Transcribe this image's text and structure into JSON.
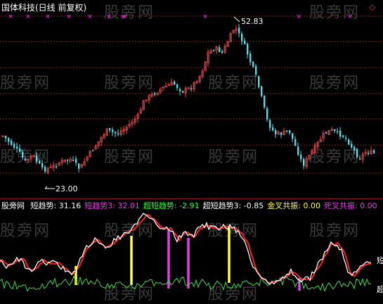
{
  "header": {
    "title": "国体科技(日线 前复权)",
    "diamond_icon": "diamond-icon"
  },
  "watermark": "股旁网",
  "price_chart": {
    "high_label": "52.83",
    "low_label": "23.00",
    "colors": {
      "up": "#ff3b3b",
      "down": "#4fe0ee",
      "grid": "#8b1a1a",
      "marker": "#ff33ff"
    }
  },
  "indicator_bar": {
    "panel_name": "股旁网",
    "items": [
      {
        "label": "短趋势: 31.16",
        "color": "#ffffff"
      },
      {
        "label": "短趋势3: 32.01",
        "color": "#e040e0"
      },
      {
        "label": "超短趋势: -2.91",
        "color": "#33ff33"
      },
      {
        "label": "超短趋势3: -0.85",
        "color": "#ffffff"
      },
      {
        "label": "金叉共振: 0.00",
        "color": "#ffff33"
      },
      {
        "label": "死叉共振: 0.00",
        "color": "#e040e0"
      }
    ]
  },
  "right_edge_labels": {
    "upper": "短",
    "lower": "超"
  },
  "indicator_chart": {
    "colors": {
      "white": "#ffffff",
      "red": "#ff2020",
      "purple": "#b03cff",
      "green": "#44dd44",
      "yellow": "#ffff33",
      "magenta": "#e040e0"
    }
  }
}
